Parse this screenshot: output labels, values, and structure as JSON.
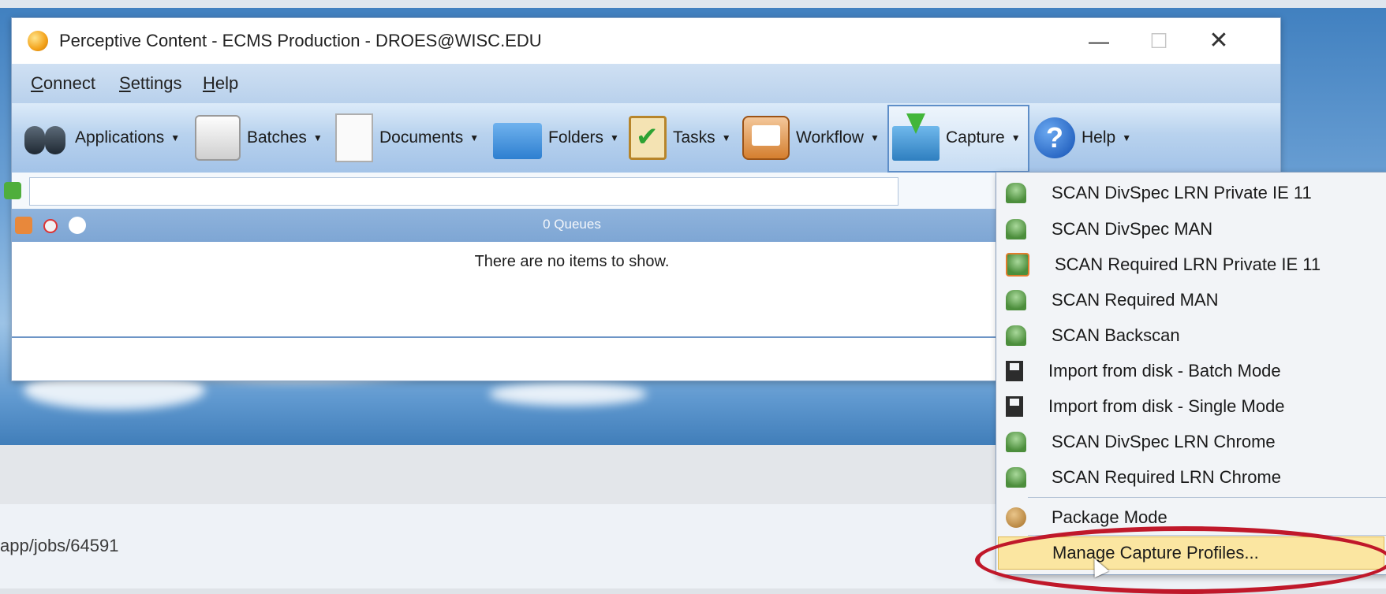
{
  "window": {
    "title": "Perceptive Content - ECMS  Production - DROES@WISC.EDU",
    "controls": {
      "minimize": "—",
      "maximize": "☐",
      "close": "✕"
    }
  },
  "menubar": [
    {
      "label": "Connect",
      "underline": "C",
      "rest": "onnect"
    },
    {
      "label": "Settings",
      "underline": "S",
      "rest": "ettings"
    },
    {
      "label": "Help",
      "underline": "H",
      "rest": "elp"
    }
  ],
  "toolbar": {
    "applications": "Applications",
    "batches": "Batches",
    "documents": "Documents",
    "folders": "Folders",
    "tasks": "Tasks",
    "workflow": "Workflow",
    "capture": "Capture",
    "help": "Help",
    "caret": "▼",
    "active": "Capture"
  },
  "search": {
    "value": ""
  },
  "queues": {
    "title": "0 Queues",
    "empty_message": "There are no items to show."
  },
  "capture_menu": {
    "items": [
      {
        "label": "SCAN DivSpec LRN Private IE 11",
        "icon": "scanner-icon"
      },
      {
        "label": "SCAN DivSpec MAN",
        "icon": "scanner-icon"
      },
      {
        "label": "SCAN Required LRN Private IE 11",
        "icon": "scanner-selected-icon"
      },
      {
        "label": "SCAN Required MAN",
        "icon": "scanner-icon"
      },
      {
        "label": "SCAN Backscan",
        "icon": "scanner-icon"
      },
      {
        "label": "Import from disk - Batch Mode",
        "icon": "disk-icon"
      },
      {
        "label": "Import from disk - Single Mode",
        "icon": "disk-icon"
      },
      {
        "label": "SCAN DivSpec LRN Chrome",
        "icon": "scanner-icon"
      },
      {
        "label": "SCAN Required LRN Chrome",
        "icon": "scanner-icon"
      }
    ],
    "package_mode": "Package Mode",
    "manage": "Manage Capture Profiles...",
    "highlighted": "Manage Capture Profiles..."
  },
  "browser": {
    "url_fragment": "app/jobs/64591"
  },
  "colors": {
    "annotation": "#c0182a",
    "highlight": "#fbe6a1"
  }
}
